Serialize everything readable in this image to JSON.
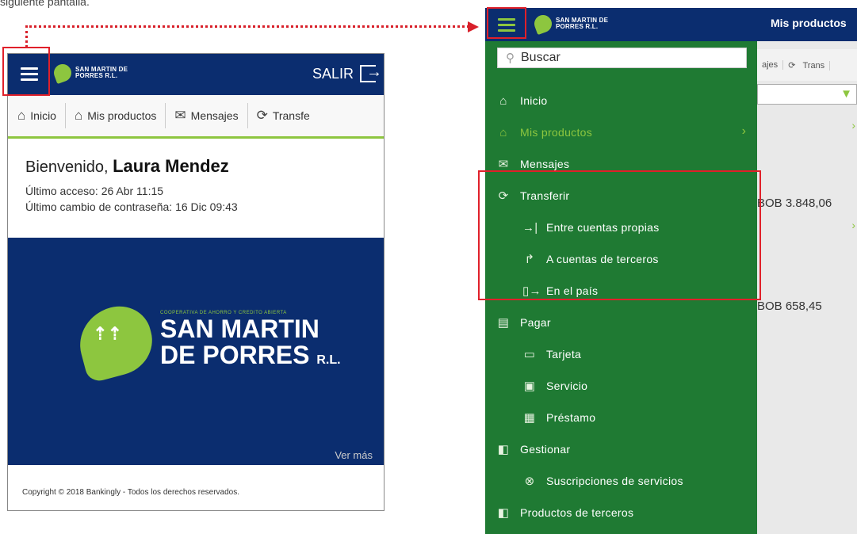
{
  "caption": "siguiente pantalla.",
  "left": {
    "logo_text": "SAN MARTIN DE PORRES R.L.",
    "salir": "SALIR",
    "tabs": [
      "Inicio",
      "Mis productos",
      "Mensajes",
      "Transfe"
    ],
    "welcome_prefix": "Bienvenido,",
    "user_name": "Laura Mendez",
    "last_access": "Último acceso: 26 Abr 11:15",
    "last_pwd_change": "Último cambio de contraseña: 16 Dic 09:43",
    "banner_small": "COOPERATIVA DE AHORRO Y CREDITO ABIERTA",
    "banner_line1": "SAN MARTIN",
    "banner_line2": "DE PORRES",
    "banner_suffix": "R.L.",
    "ver_mas": "Ver más",
    "copyright": "Copyright © 2018 Bankingly - Todos los derechos reservados."
  },
  "right": {
    "header_title": "Mis productos",
    "search_placeholder": "Buscar",
    "bg_tabs": [
      "ajes",
      "Trans"
    ],
    "bg_amounts": [
      "BOB 3.848,06",
      "BOB 658,45"
    ],
    "menu": [
      {
        "label": "Inicio",
        "icon": "home-icon",
        "sub": false
      },
      {
        "label": "Mis productos",
        "icon": "bank-icon",
        "sub": false,
        "active": true
      },
      {
        "label": "Mensajes",
        "icon": "inbox-icon",
        "sub": false
      },
      {
        "label": "Transferir",
        "icon": "transfer-icon",
        "sub": false
      },
      {
        "label": "Entre cuentas propias",
        "icon": "arrow-bar-icon",
        "sub": true
      },
      {
        "label": "A cuentas de terceros",
        "icon": "arrow-turn-icon",
        "sub": true
      },
      {
        "label": "En el país",
        "icon": "door-arrow-icon",
        "sub": true
      },
      {
        "label": "Pagar",
        "icon": "pay-icon",
        "sub": false
      },
      {
        "label": "Tarjeta",
        "icon": "card-icon",
        "sub": true
      },
      {
        "label": "Servicio",
        "icon": "service-icon",
        "sub": true
      },
      {
        "label": "Préstamo",
        "icon": "loan-icon",
        "sub": true
      },
      {
        "label": "Gestionar",
        "icon": "manage-icon",
        "sub": false
      },
      {
        "label": "Suscripciones de servicios",
        "icon": "subscription-icon",
        "sub": true
      },
      {
        "label": "Productos de terceros",
        "icon": "third-party-icon",
        "sub": false
      }
    ]
  },
  "colors": {
    "navy": "#0b2d6f",
    "green": "#1f7a33",
    "lime": "#8dc63f",
    "highlight": "#d8202a"
  }
}
